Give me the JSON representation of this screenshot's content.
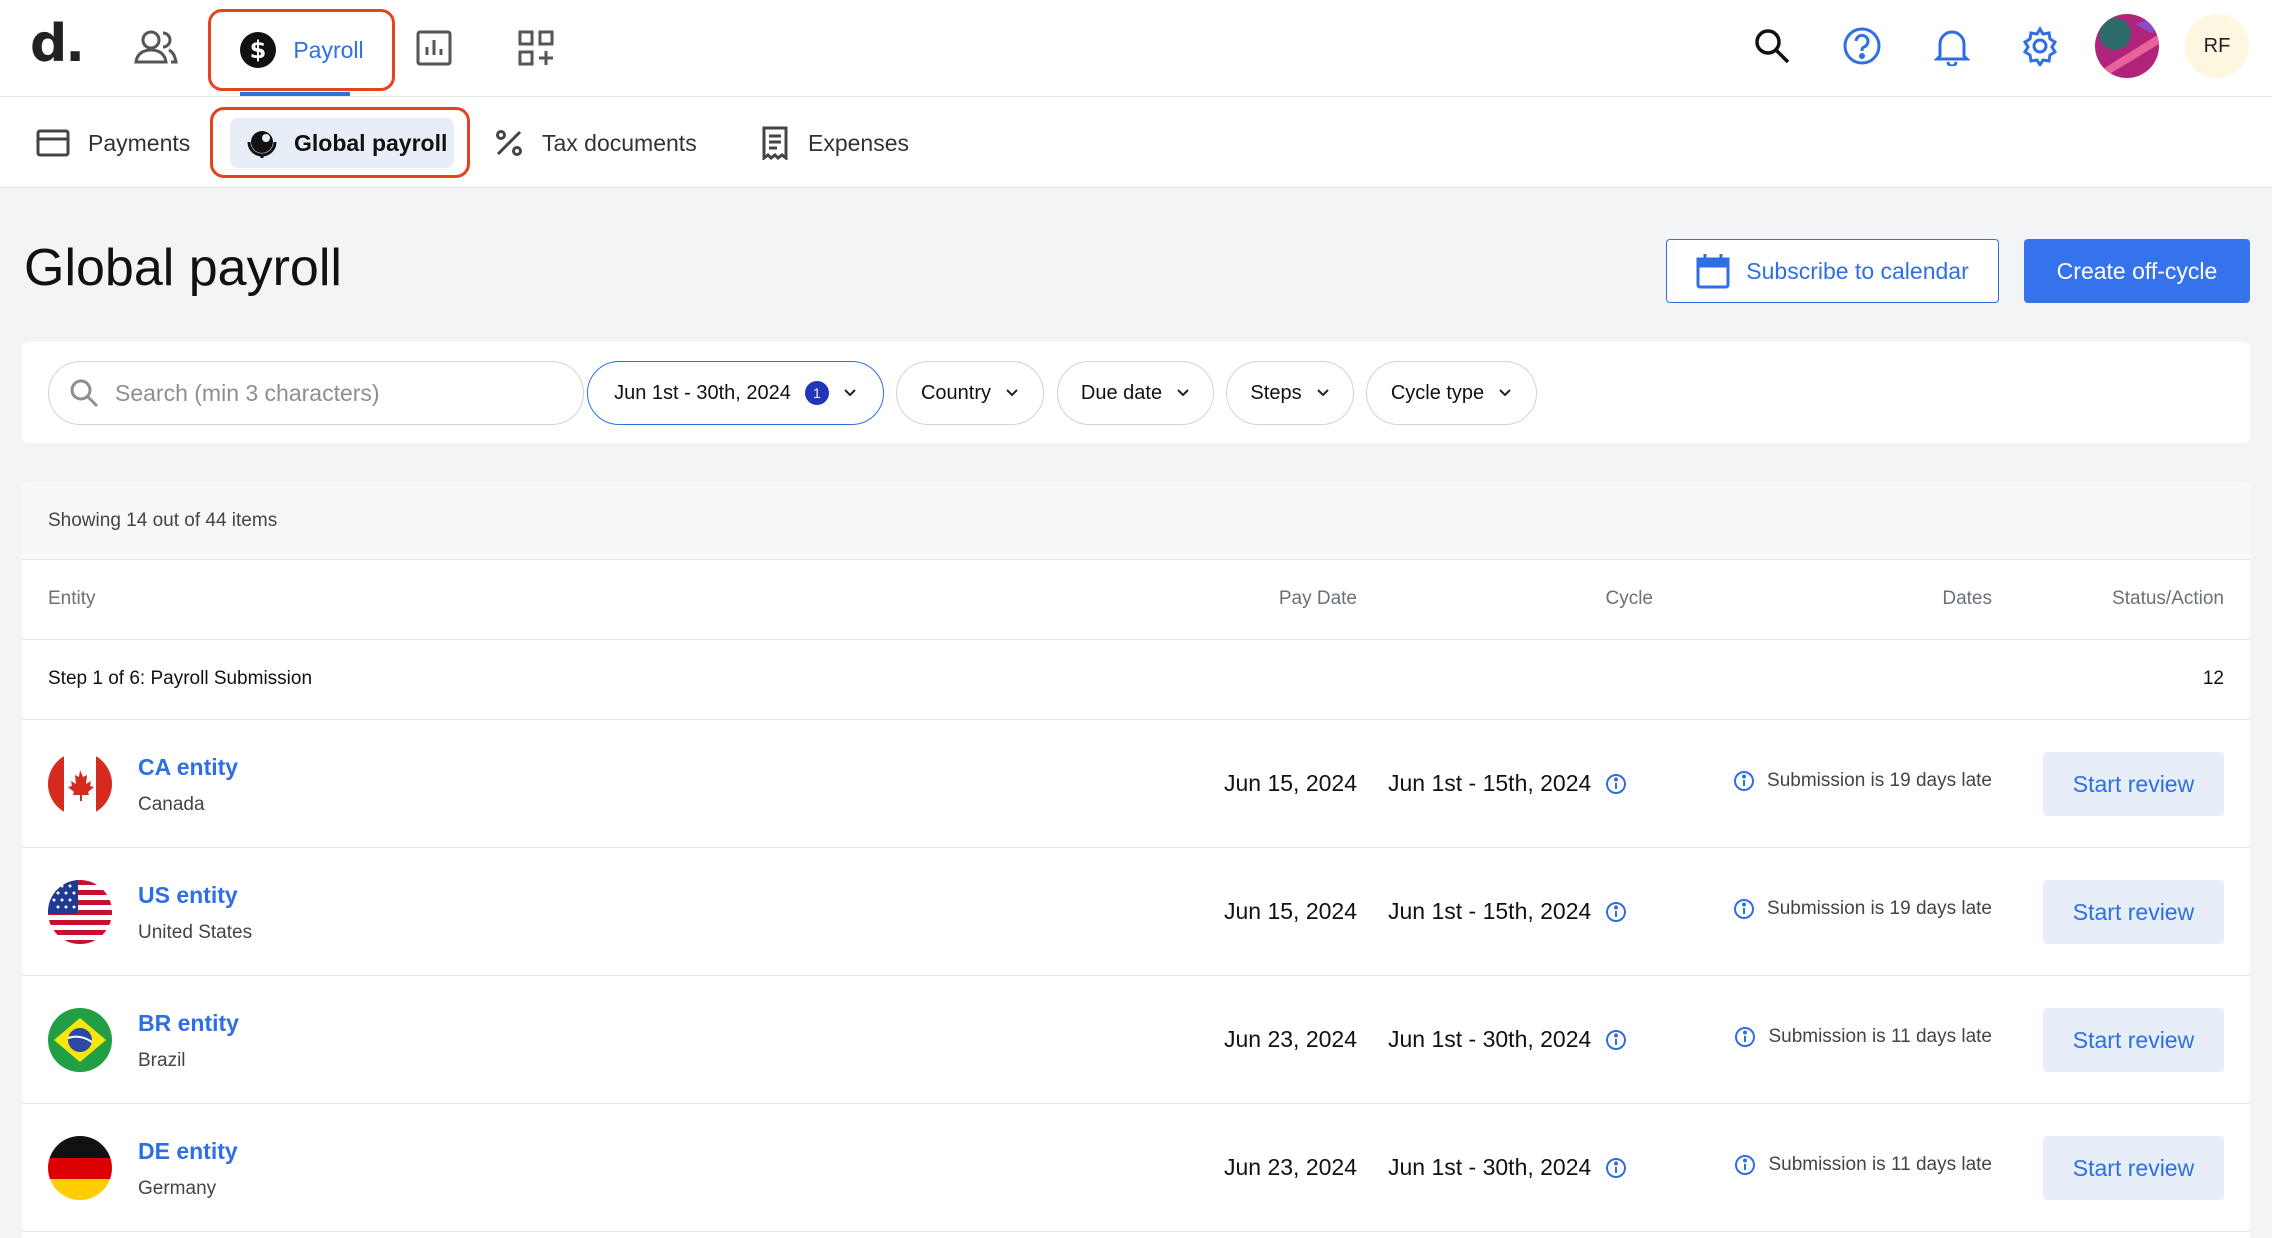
{
  "brand": {
    "logo_text": "d."
  },
  "topnav": {
    "payroll_label": "Payroll",
    "user_initials": "RF"
  },
  "subnav": {
    "payments": "Payments",
    "global_payroll": "Global payroll",
    "tax_documents": "Tax documents",
    "expenses": "Expenses"
  },
  "header": {
    "title": "Global payroll",
    "subscribe_label": "Subscribe to calendar",
    "create_label": "Create off-cycle"
  },
  "filters": {
    "search_placeholder": "Search (min 3 characters)",
    "date_range": "Jun 1st - 30th, 2024",
    "date_range_count": "1",
    "country": "Country",
    "due_date": "Due date",
    "steps": "Steps",
    "cycle_type": "Cycle type"
  },
  "table": {
    "showing": "Showing 14 out of 44 items",
    "columns": {
      "entity": "Entity",
      "pay_date": "Pay Date",
      "cycle": "Cycle",
      "dates": "Dates",
      "status": "Status/Action"
    },
    "step_group": {
      "label": "Step 1 of 6: Payroll Submission",
      "count": "12"
    },
    "rows": [
      {
        "name": "CA entity",
        "country": "Canada",
        "pay_date": "Jun 15, 2024",
        "cycle": "Jun 1st - 15th, 2024",
        "status": "Submission is 19 days late",
        "action": "Start review"
      },
      {
        "name": "US entity",
        "country": "United States",
        "pay_date": "Jun 15, 2024",
        "cycle": "Jun 1st - 15th, 2024",
        "status": "Submission is 19 days late",
        "action": "Start review"
      },
      {
        "name": "BR entity",
        "country": "Brazil",
        "pay_date": "Jun 23, 2024",
        "cycle": "Jun 1st - 30th, 2024",
        "status": "Submission is 11 days late",
        "action": "Start review"
      },
      {
        "name": "DE entity",
        "country": "Germany",
        "pay_date": "Jun 23, 2024",
        "cycle": "Jun 1st - 30th, 2024",
        "status": "Submission is 11 days late",
        "action": "Start review"
      }
    ]
  },
  "colors": {
    "accent": "#2f6fe4",
    "primary_button": "#3573ec",
    "highlight_outline": "#e3441f",
    "badge": "#2335b8"
  }
}
